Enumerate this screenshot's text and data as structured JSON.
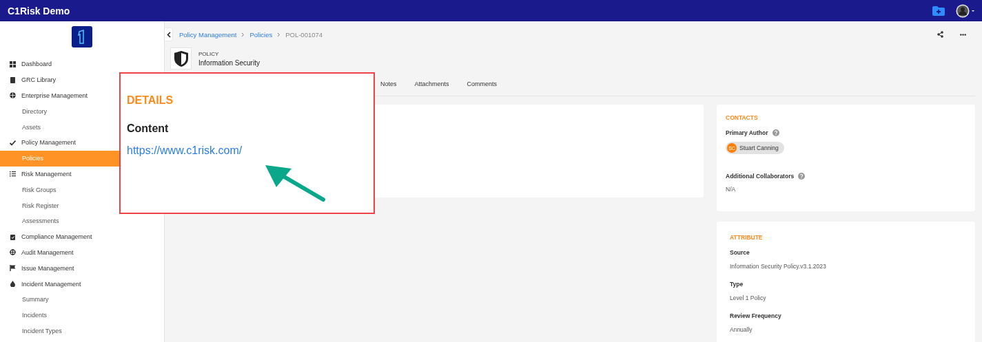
{
  "app": {
    "title": "C1Risk Demo"
  },
  "sidebar": {
    "items": [
      {
        "kind": "section",
        "label": "Dashboard",
        "selected": false
      },
      {
        "kind": "section",
        "label": "GRC Library",
        "selected": false
      },
      {
        "kind": "section",
        "label": "Enterprise Management",
        "selected": false
      },
      {
        "kind": "sub",
        "label": "Directory",
        "selected": false
      },
      {
        "kind": "sub",
        "label": "Assets",
        "selected": false
      },
      {
        "kind": "section",
        "label": "Policy Management",
        "selected": false
      },
      {
        "kind": "sub",
        "label": "Policies",
        "selected": true
      },
      {
        "kind": "section",
        "label": "Risk Management",
        "selected": false
      },
      {
        "kind": "sub",
        "label": "Risk Groups",
        "selected": false
      },
      {
        "kind": "sub",
        "label": "Risk Register",
        "selected": false
      },
      {
        "kind": "sub",
        "label": "Assessments",
        "selected": false
      },
      {
        "kind": "section",
        "label": "Compliance Management",
        "selected": false
      },
      {
        "kind": "section",
        "label": "Audit Management",
        "selected": false
      },
      {
        "kind": "section",
        "label": "Issue Management",
        "selected": false
      },
      {
        "kind": "section",
        "label": "Incident Management",
        "selected": false
      },
      {
        "kind": "sub",
        "label": "Summary",
        "selected": false
      },
      {
        "kind": "sub",
        "label": "Incidents",
        "selected": false
      },
      {
        "kind": "sub",
        "label": "Incident Types",
        "selected": false
      }
    ]
  },
  "breadcrumb": [
    {
      "label": "Policy Management",
      "kind": "link"
    },
    {
      "label": "Policies",
      "kind": "link"
    },
    {
      "label": "POL-001074",
      "kind": "current"
    }
  ],
  "record": {
    "type": "POLICY",
    "name": "Information Security"
  },
  "tabs": [
    {
      "label": "Notes",
      "selected": false
    },
    {
      "label": "Attachments",
      "selected": false
    },
    {
      "label": "Comments",
      "selected": false
    }
  ],
  "contacts": {
    "title": "CONTACTS",
    "primary_author": {
      "label": "Primary Author",
      "initials": "SC",
      "name": "Stuart Canning"
    },
    "collaborators": {
      "label": "Additional Collaborators",
      "value": "N/A"
    }
  },
  "attribute": {
    "title": "ATTRIBUTE",
    "fields": [
      {
        "label": "Source",
        "value": "Information Security Policy.v3.1.2023"
      },
      {
        "label": "Type",
        "value": "Level 1 Policy"
      },
      {
        "label": "Review Frequency",
        "value": "Annually"
      }
    ]
  },
  "callout": {
    "title": "DETAILS",
    "label": "Content",
    "link": "https://www.c1risk.com/"
  }
}
